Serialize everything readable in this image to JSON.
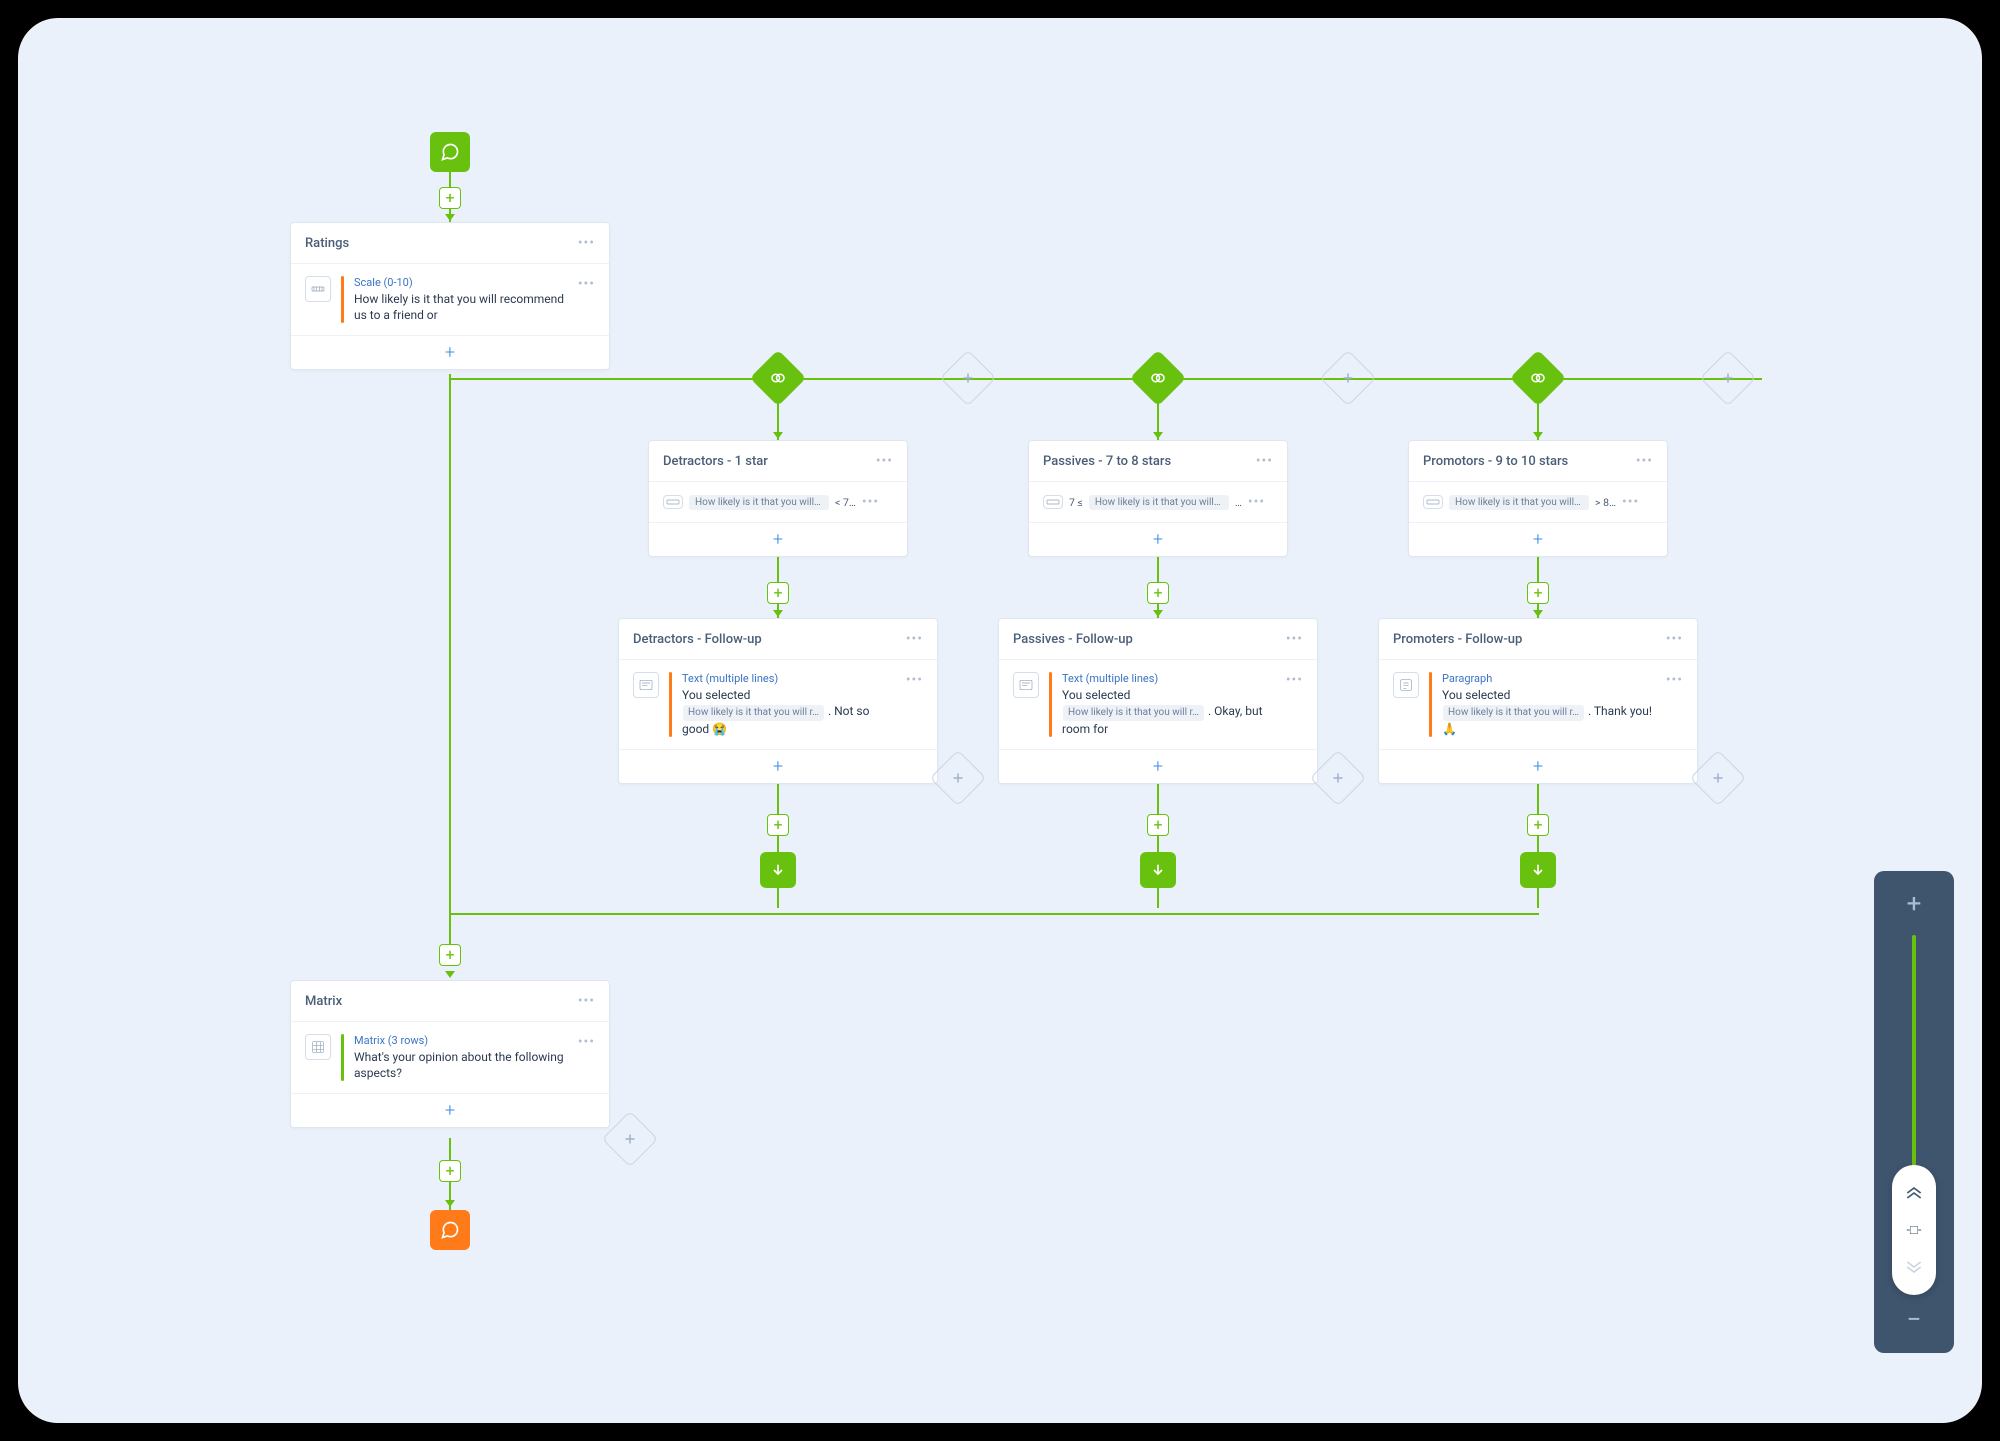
{
  "colors": {
    "green": "#69c10f",
    "orange": "#ff7a18",
    "blue": "#3a8de6"
  },
  "start": {
    "icon": "chat-icon"
  },
  "end": {
    "icon": "chat-icon"
  },
  "ratings": {
    "title": "Ratings",
    "question": {
      "type_label": "Scale (0-10)",
      "text": "How likely is it that you will recommend us to a friend or"
    }
  },
  "branches": [
    {
      "cond_title": "Detractors - 1 star",
      "cond_text_prefix": "How likely is it that you will r…",
      "cond_op": "< 7…",
      "follow_title": "Detractors - Follow-up",
      "follow_type": "Text (multiple lines)",
      "follow_prefix": "You selected",
      "follow_pill": "How likely is it that you will r…",
      "follow_suffix": ". Not so good 😭"
    },
    {
      "cond_title": "Passives - 7 to 8 stars",
      "cond_text_prefix": "How likely is it that you will r…",
      "cond_range": "7 ≤",
      "cond_op": "…",
      "follow_title": "Passives - Follow-up",
      "follow_type": "Text (multiple lines)",
      "follow_prefix": "You selected",
      "follow_pill": "How likely is it that you will r…",
      "follow_suffix": ". Okay, but room for"
    },
    {
      "cond_title": "Promotors - 9 to 10 stars",
      "cond_text_prefix": "How likely is it that you will r…",
      "cond_op": "> 8…",
      "follow_title": "Promoters - Follow-up",
      "follow_type": "Paragraph",
      "follow_prefix": "You selected",
      "follow_pill": "How likely is it that you will r…",
      "follow_suffix": ". Thank you! 🙏"
    }
  ],
  "matrix": {
    "title": "Matrix",
    "question": {
      "type_label": "Matrix (3 rows)",
      "text": "What's your opinion about the following aspects?"
    }
  }
}
